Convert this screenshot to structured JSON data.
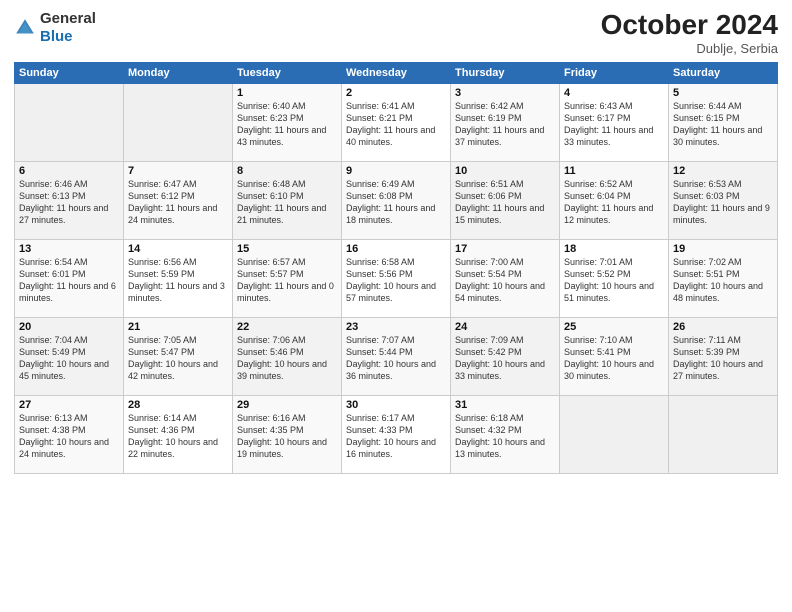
{
  "header": {
    "logo_general": "General",
    "logo_blue": "Blue",
    "month_title": "October 2024",
    "subtitle": "Dublje, Serbia"
  },
  "weekdays": [
    "Sunday",
    "Monday",
    "Tuesday",
    "Wednesday",
    "Thursday",
    "Friday",
    "Saturday"
  ],
  "days": [
    {
      "num": "",
      "info": ""
    },
    {
      "num": "",
      "info": ""
    },
    {
      "num": "1",
      "info": "Sunrise: 6:40 AM\nSunset: 6:23 PM\nDaylight: 11 hours\nand 43 minutes."
    },
    {
      "num": "2",
      "info": "Sunrise: 6:41 AM\nSunset: 6:21 PM\nDaylight: 11 hours\nand 40 minutes."
    },
    {
      "num": "3",
      "info": "Sunrise: 6:42 AM\nSunset: 6:19 PM\nDaylight: 11 hours\nand 37 minutes."
    },
    {
      "num": "4",
      "info": "Sunrise: 6:43 AM\nSunset: 6:17 PM\nDaylight: 11 hours\nand 33 minutes."
    },
    {
      "num": "5",
      "info": "Sunrise: 6:44 AM\nSunset: 6:15 PM\nDaylight: 11 hours\nand 30 minutes."
    },
    {
      "num": "6",
      "info": "Sunrise: 6:46 AM\nSunset: 6:13 PM\nDaylight: 11 hours\nand 27 minutes."
    },
    {
      "num": "7",
      "info": "Sunrise: 6:47 AM\nSunset: 6:12 PM\nDaylight: 11 hours\nand 24 minutes."
    },
    {
      "num": "8",
      "info": "Sunrise: 6:48 AM\nSunset: 6:10 PM\nDaylight: 11 hours\nand 21 minutes."
    },
    {
      "num": "9",
      "info": "Sunrise: 6:49 AM\nSunset: 6:08 PM\nDaylight: 11 hours\nand 18 minutes."
    },
    {
      "num": "10",
      "info": "Sunrise: 6:51 AM\nSunset: 6:06 PM\nDaylight: 11 hours\nand 15 minutes."
    },
    {
      "num": "11",
      "info": "Sunrise: 6:52 AM\nSunset: 6:04 PM\nDaylight: 11 hours\nand 12 minutes."
    },
    {
      "num": "12",
      "info": "Sunrise: 6:53 AM\nSunset: 6:03 PM\nDaylight: 11 hours\nand 9 minutes."
    },
    {
      "num": "13",
      "info": "Sunrise: 6:54 AM\nSunset: 6:01 PM\nDaylight: 11 hours\nand 6 minutes."
    },
    {
      "num": "14",
      "info": "Sunrise: 6:56 AM\nSunset: 5:59 PM\nDaylight: 11 hours\nand 3 minutes."
    },
    {
      "num": "15",
      "info": "Sunrise: 6:57 AM\nSunset: 5:57 PM\nDaylight: 11 hours\nand 0 minutes."
    },
    {
      "num": "16",
      "info": "Sunrise: 6:58 AM\nSunset: 5:56 PM\nDaylight: 10 hours\nand 57 minutes."
    },
    {
      "num": "17",
      "info": "Sunrise: 7:00 AM\nSunset: 5:54 PM\nDaylight: 10 hours\nand 54 minutes."
    },
    {
      "num": "18",
      "info": "Sunrise: 7:01 AM\nSunset: 5:52 PM\nDaylight: 10 hours\nand 51 minutes."
    },
    {
      "num": "19",
      "info": "Sunrise: 7:02 AM\nSunset: 5:51 PM\nDaylight: 10 hours\nand 48 minutes."
    },
    {
      "num": "20",
      "info": "Sunrise: 7:04 AM\nSunset: 5:49 PM\nDaylight: 10 hours\nand 45 minutes."
    },
    {
      "num": "21",
      "info": "Sunrise: 7:05 AM\nSunset: 5:47 PM\nDaylight: 10 hours\nand 42 minutes."
    },
    {
      "num": "22",
      "info": "Sunrise: 7:06 AM\nSunset: 5:46 PM\nDaylight: 10 hours\nand 39 minutes."
    },
    {
      "num": "23",
      "info": "Sunrise: 7:07 AM\nSunset: 5:44 PM\nDaylight: 10 hours\nand 36 minutes."
    },
    {
      "num": "24",
      "info": "Sunrise: 7:09 AM\nSunset: 5:42 PM\nDaylight: 10 hours\nand 33 minutes."
    },
    {
      "num": "25",
      "info": "Sunrise: 7:10 AM\nSunset: 5:41 PM\nDaylight: 10 hours\nand 30 minutes."
    },
    {
      "num": "26",
      "info": "Sunrise: 7:11 AM\nSunset: 5:39 PM\nDaylight: 10 hours\nand 27 minutes."
    },
    {
      "num": "27",
      "info": "Sunrise: 6:13 AM\nSunset: 4:38 PM\nDaylight: 10 hours\nand 24 minutes."
    },
    {
      "num": "28",
      "info": "Sunrise: 6:14 AM\nSunset: 4:36 PM\nDaylight: 10 hours\nand 22 minutes."
    },
    {
      "num": "29",
      "info": "Sunrise: 6:16 AM\nSunset: 4:35 PM\nDaylight: 10 hours\nand 19 minutes."
    },
    {
      "num": "30",
      "info": "Sunrise: 6:17 AM\nSunset: 4:33 PM\nDaylight: 10 hours\nand 16 minutes."
    },
    {
      "num": "31",
      "info": "Sunrise: 6:18 AM\nSunset: 4:32 PM\nDaylight: 10 hours\nand 13 minutes."
    },
    {
      "num": "",
      "info": ""
    },
    {
      "num": "",
      "info": ""
    }
  ]
}
